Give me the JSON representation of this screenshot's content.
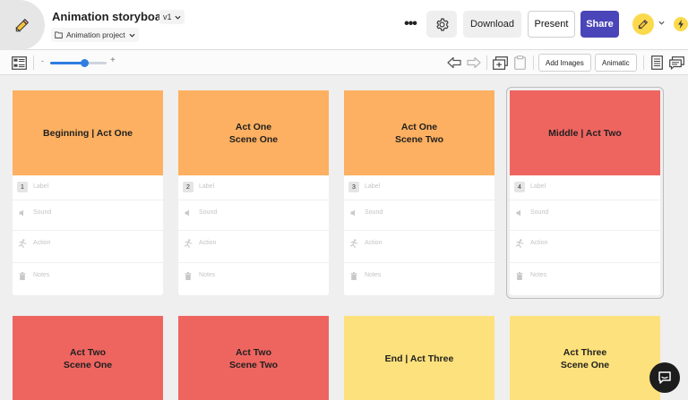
{
  "header": {
    "title": "Animation storyboard",
    "version": "v1",
    "project": "Animation project",
    "more_label": "•••",
    "download_label": "Download",
    "present_label": "Present",
    "share_label": "Share"
  },
  "toolbar": {
    "zoom_minus": "-",
    "zoom_plus": "+",
    "zoom_level": 0.6,
    "add_images_label": "Add Images",
    "animatic_label": "Animatic"
  },
  "fields": {
    "label_placeholder": "Label",
    "sound_placeholder": "Sound",
    "action_placeholder": "Action",
    "notes_placeholder": "Notes"
  },
  "colors": {
    "orange": "#fdb061",
    "red": "#ee6560",
    "yellow": "#fde17c",
    "accent": "#4a45b8"
  },
  "frames": [
    {
      "number": "1",
      "title": "Beginning | Act One",
      "color": "#fdb061"
    },
    {
      "number": "2",
      "title": "Act One\nScene One",
      "color": "#fdb061"
    },
    {
      "number": "3",
      "title": "Act One\nScene Two",
      "color": "#fdb061"
    },
    {
      "number": "4",
      "title": "Middle | Act Two",
      "color": "#ee6560"
    },
    {
      "number": "",
      "title": "Act Two\nScene One",
      "color": "#ee6560"
    },
    {
      "number": "",
      "title": "Act Two\nScene Two",
      "color": "#ee6560"
    },
    {
      "number": "",
      "title": "End | Act Three",
      "color": "#fde17c"
    },
    {
      "number": "",
      "title": "Act Three\nScene One",
      "color": "#fde17c"
    }
  ],
  "icons": [
    "pencil-icon",
    "folder-icon",
    "chevron-down-icon",
    "gear-icon",
    "lightning-icon",
    "storyboard-view-icon",
    "undo-arrow-icon",
    "redo-arrow-icon",
    "add-frames-icon",
    "clipboard-icon",
    "script-icon",
    "comments-icon",
    "speaker-icon",
    "running-figure-icon",
    "trash-icon",
    "chat-icon"
  ]
}
